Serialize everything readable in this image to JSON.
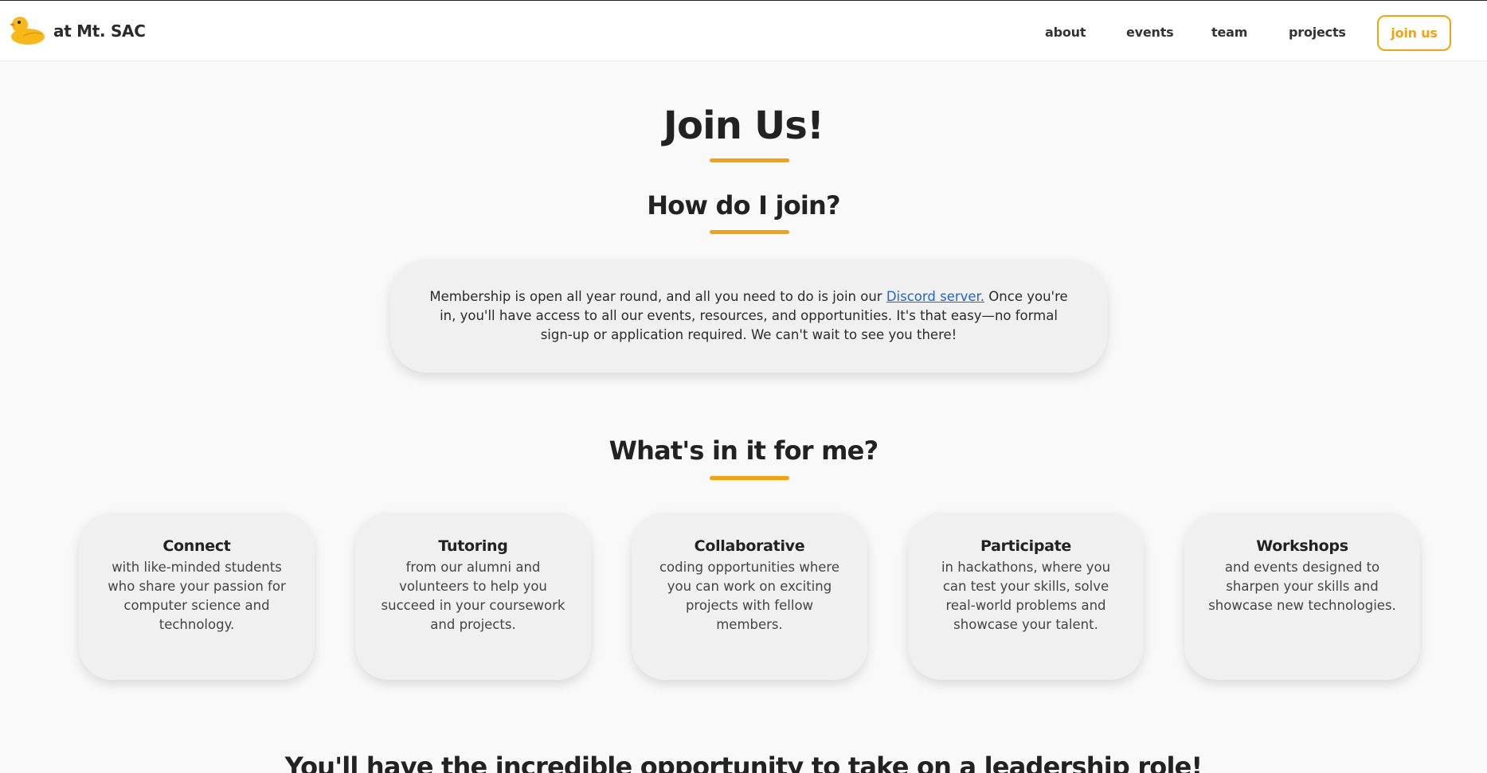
{
  "header": {
    "brand": "at Mt. SAC",
    "logo_icon": "rubber-duck-icon",
    "nav": [
      {
        "label": "about"
      },
      {
        "label": "events"
      },
      {
        "label": "team"
      },
      {
        "label": "projects"
      }
    ],
    "join_button": "join us"
  },
  "main": {
    "title": "Join Us!",
    "how_heading": "How do I join?",
    "intro": {
      "text_before": "Membership is open all year round, and all you need to do is join our ",
      "link_text": "Discord server.",
      "text_after": " Once you're in, you'll have access to all our events, resources, and opportunities. It's that easy—no formal sign-up or application required. We can't wait to see you there!"
    },
    "benefits_heading": "What's in it for me?",
    "benefits": [
      {
        "title": "Connect",
        "desc": "with like-minded students who share your passion for computer science and technology."
      },
      {
        "title": "Tutoring",
        "desc": "from our alumni and volunteers to help you succeed in your coursework and projects."
      },
      {
        "title": "Collaborative",
        "desc": "coding opportunities where you can work on exciting projects with fellow members."
      },
      {
        "title": "Participate",
        "desc": "in hackathons, where you can test your skills, solve real-world problems and showcase your talent."
      },
      {
        "title": "Workshops",
        "desc": "and events designed to sharpen your skills and showcase new technologies."
      }
    ],
    "leadership_heading": "You'll have the incredible opportunity to take on a leadership role!"
  },
  "colors": {
    "accent": "#f5a30a",
    "link": "#1a66d6",
    "page_background": "#f9f9f9",
    "card_background": "#f0f0f0"
  }
}
